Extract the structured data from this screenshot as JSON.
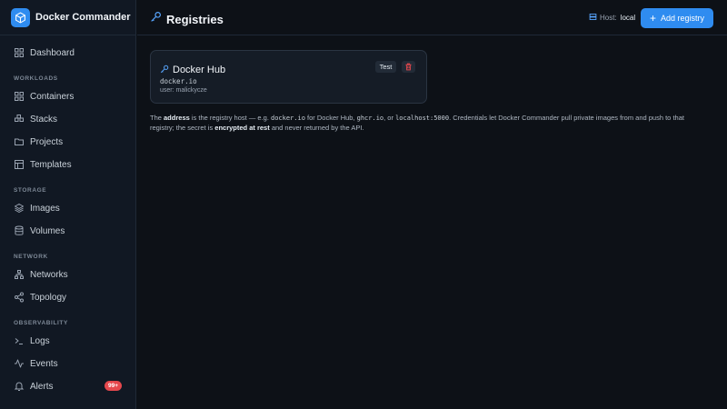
{
  "brand": {
    "name": "Docker Commander"
  },
  "sidebar": {
    "dashboard": "Dashboard",
    "sections": {
      "workloads": "WORKLOADS",
      "storage": "STORAGE",
      "network": "NETWORK",
      "observability": "OBSERVABILITY"
    },
    "items": {
      "containers": "Containers",
      "stacks": "Stacks",
      "projects": "Projects",
      "templates": "Templates",
      "images": "Images",
      "volumes": "Volumes",
      "networks": "Networks",
      "topology": "Topology",
      "logs": "Logs",
      "events": "Events",
      "alerts": "Alerts"
    },
    "alerts_badge": "99+"
  },
  "header": {
    "title": "Registries",
    "host_label": "Host:",
    "host_value": "local",
    "add_button": "Add registry"
  },
  "registries": [
    {
      "name": "Docker Hub",
      "address": "docker.io",
      "user": "user: malickycze",
      "test_label": "Test"
    }
  ],
  "help": {
    "p1": "The ",
    "b1": "address",
    "p2": " is the registry host — e.g. ",
    "c1": "docker.io",
    "p3": " for Docker Hub, ",
    "c2": "ghcr.io",
    "p4": ", or ",
    "c3": "localhost:5000",
    "p5": ". Credentials let Docker Commander pull private images from and push to that registry; the secret is ",
    "b2": "encrypted at rest",
    "p6": " and never returned by the API."
  },
  "colors": {
    "accent": "#2f8cf0",
    "danger": "#e5484d",
    "background": "#0d1117",
    "sidebar": "#111823"
  }
}
